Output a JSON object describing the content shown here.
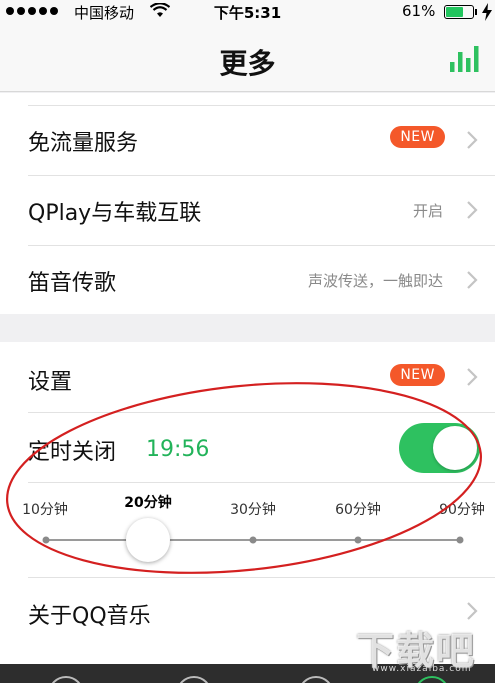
{
  "status_bar": {
    "carrier": "中国移动",
    "time": "下午5:31",
    "battery_percent": "61%",
    "battery_level": 0.61,
    "signal_icon": "signal-dots-icon",
    "wifi_icon": "wifi-icon",
    "charging_icon": "bolt-icon"
  },
  "nav": {
    "title": "更多",
    "right_icon": "equalizer-icon",
    "accent_color": "#2ec160"
  },
  "group1": {
    "items": [
      {
        "label": "免流量服务",
        "badge": "NEW"
      },
      {
        "label": "QPlay与车载互联",
        "value": "开启"
      },
      {
        "label": "笛音传歌",
        "value": "声波传送，一触即达"
      }
    ]
  },
  "group2": {
    "settings": {
      "label": "设置",
      "badge": "NEW"
    },
    "timer": {
      "label": "定时关闭",
      "value": "19:56",
      "enabled": true
    },
    "timer_options": [
      "10分钟",
      "20分钟",
      "30分钟",
      "60分钟",
      "90分钟"
    ],
    "timer_selected": "20分钟",
    "about": {
      "label": "关于QQ音乐"
    }
  },
  "colors": {
    "badge": "#f4582a",
    "toggle_on": "#2ec160",
    "timer_text": "#22b35a",
    "annotation": "#d42020"
  },
  "watermark": {
    "text": "下载吧",
    "url": "www.xiazaiba.com"
  }
}
